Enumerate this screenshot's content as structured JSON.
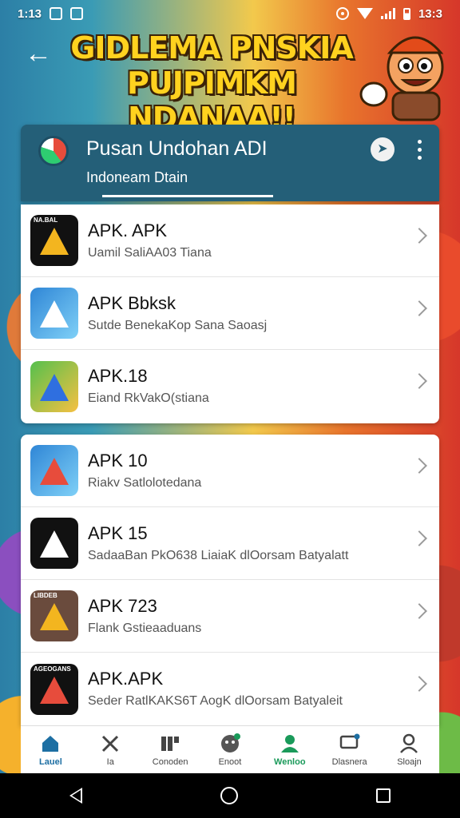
{
  "status_bar": {
    "time_left": "1:13",
    "time_right": "13:3"
  },
  "banner": {
    "line1": "GIDLEMA PNSKIA",
    "line2": "PUJPIMKM NDANAA!!"
  },
  "header": {
    "title": "Pusan Undohan ADI",
    "subtitle": "Indoneam Dtain"
  },
  "apps": [
    {
      "name": "APK. APK",
      "desc": "Uamil SaliAA03 Tiana",
      "icon_label": "NA.BAL"
    },
    {
      "name": "APK Bbksk",
      "desc": "Sutde BenekaKop Sana Saoasj",
      "icon_label": ""
    },
    {
      "name": "APK.18",
      "desc": "Eiand RkVakO(stiana",
      "icon_label": ""
    },
    {
      "name": "APK 10",
      "desc": "Riakv Satlolotedana",
      "icon_label": ""
    },
    {
      "name": "APK 15",
      "desc": "SadaaBan PkO638 LiaiaK dlOorsam Batyalatt",
      "icon_label": ""
    },
    {
      "name": "APK 723",
      "desc": "Flank Gstieaaduans",
      "icon_label": "LIBDEB"
    },
    {
      "name": "APK.APK",
      "desc": "Seder RatlKAKS6T AogK dlOorsam Batyaleit",
      "icon_label": "AGEOGANS"
    }
  ],
  "bottom_nav": [
    {
      "label": "Lauel",
      "icon": "home-icon"
    },
    {
      "label": "Ia",
      "icon": "tools-icon"
    },
    {
      "label": "Conoden",
      "icon": "grid-icon"
    },
    {
      "label": "Enoot",
      "icon": "face-icon"
    },
    {
      "label": "Wenloo",
      "icon": "person-green-icon"
    },
    {
      "label": "Dlasnera",
      "icon": "chat-icon"
    },
    {
      "label": "Sloajn",
      "icon": "profile-icon"
    }
  ],
  "colors": {
    "header_bg": "#245f78",
    "accent": "#1d6fa3",
    "banner_text": "#ffd21f"
  }
}
